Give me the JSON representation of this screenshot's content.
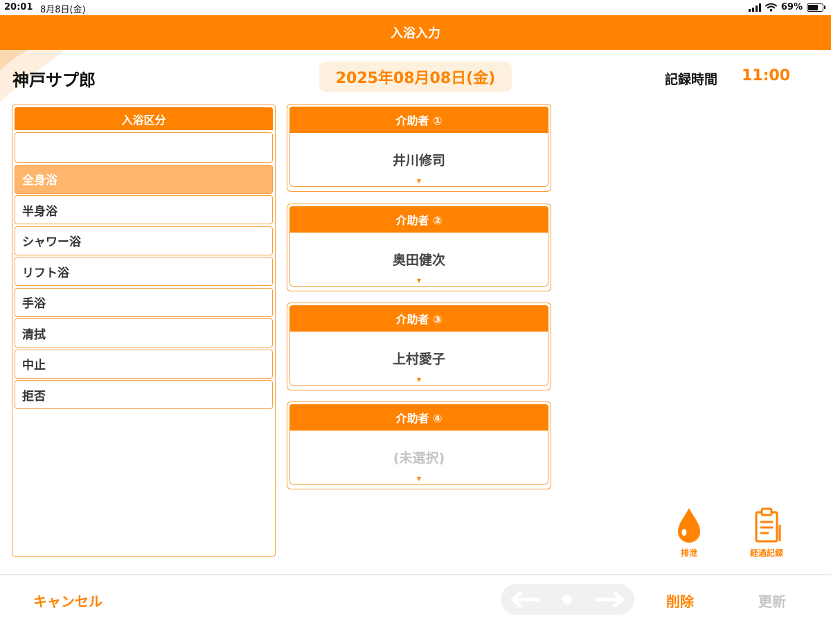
{
  "status_bar": {
    "time": "20:01",
    "date": "8月8日(金)",
    "battery": "69%",
    "battery_level": 0.69
  },
  "title": "入浴入力",
  "header": {
    "resident_name": "神戸サプ郎",
    "record_date": "2025年08月08日(金)",
    "record_time_label": "記録時間",
    "record_time": "11:00"
  },
  "bath_type": {
    "title": "入浴区分",
    "blank_option": "",
    "options": [
      "全身浴",
      "半身浴",
      "シャワー浴",
      "リフト浴",
      "手浴",
      "清拭",
      "中止",
      "拒否"
    ],
    "selected": "全身浴"
  },
  "helpers": [
    {
      "label": "介助者 ①",
      "value": "井川修司"
    },
    {
      "label": "介助者 ②",
      "value": "奥田健次"
    },
    {
      "label": "介助者 ③",
      "value": "上村愛子"
    },
    {
      "label": "介助者 ④",
      "value": "(未選択)"
    }
  ],
  "shortcuts": {
    "excretion_label": "排泄",
    "progress_label": "経過記録"
  },
  "footer": {
    "cancel_label": "キャンセル",
    "delete_label": "削除",
    "update_label": "更新"
  },
  "colors": {
    "accent": "#ff8200",
    "selected_bg": "#ffb56b",
    "date_bg": "#fdf0dc",
    "disabled": "#c6c6c6"
  }
}
